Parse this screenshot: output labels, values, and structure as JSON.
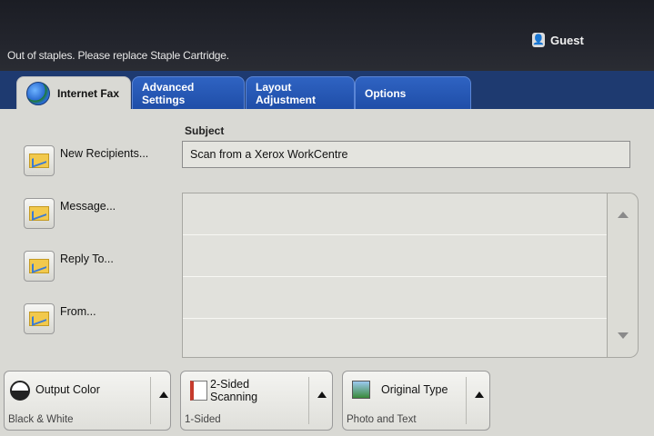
{
  "header": {
    "status_message": "Out of staples. Please replace Staple Cartridge.",
    "user": "Guest"
  },
  "tabs": [
    {
      "label": "Internet Fax",
      "active": true
    },
    {
      "label": "Advanced Settings",
      "active": false
    },
    {
      "label": "Layout Adjustment",
      "active": false
    },
    {
      "label": "Options",
      "active": false
    }
  ],
  "left_buttons": [
    {
      "label": "New Recipients..."
    },
    {
      "label": "Message..."
    },
    {
      "label": "Reply To..."
    },
    {
      "label": "From..."
    }
  ],
  "subject": {
    "label": "Subject",
    "value": "Scan from a Xerox WorkCentre"
  },
  "bottom_options": [
    {
      "title": "Output Color",
      "value": "Black & White"
    },
    {
      "title": "2-Sided Scanning",
      "value": "1-Sided"
    },
    {
      "title": "Original Type",
      "value": "Photo and Text"
    }
  ],
  "colors": {
    "tab_blue": "#2f63c2",
    "header_dark": "#1b1d24",
    "panel": "#d9d9d4"
  }
}
